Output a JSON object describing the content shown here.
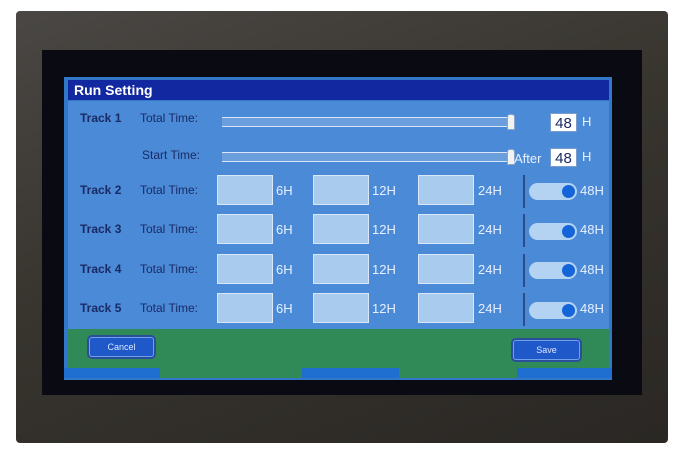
{
  "window": {
    "title": "Run Setting"
  },
  "track1": {
    "label": "Track 1",
    "total_time_label": "Total Time:",
    "total_time_value": "48",
    "total_time_unit": "H",
    "start_time_label": "Start Time:",
    "start_after_label": "After",
    "start_time_value": "48",
    "start_time_unit": "H"
  },
  "rows": [
    {
      "track": "Track 2",
      "label": "Total Time:",
      "options": [
        "6H",
        "12H",
        "24H",
        "48H"
      ],
      "selected": "48H"
    },
    {
      "track": "Track 3",
      "label": "Total Time:",
      "options": [
        "6H",
        "12H",
        "24H",
        "48H"
      ],
      "selected": "48H"
    },
    {
      "track": "Track 4",
      "label": "Total Time:",
      "options": [
        "6H",
        "12H",
        "24H",
        "48H"
      ],
      "selected": "48H"
    },
    {
      "track": "Track 5",
      "label": "Total Time:",
      "options": [
        "6H",
        "12H",
        "24H",
        "48H"
      ],
      "selected": "48H"
    }
  ],
  "footer": {
    "cancel_label": "Cancel",
    "save_label": "Save"
  },
  "colors": {
    "title_bar": "#1228a0",
    "panel": "#4a8ad6",
    "footer": "#2f8a58",
    "toggle_on": "#1565d8"
  }
}
